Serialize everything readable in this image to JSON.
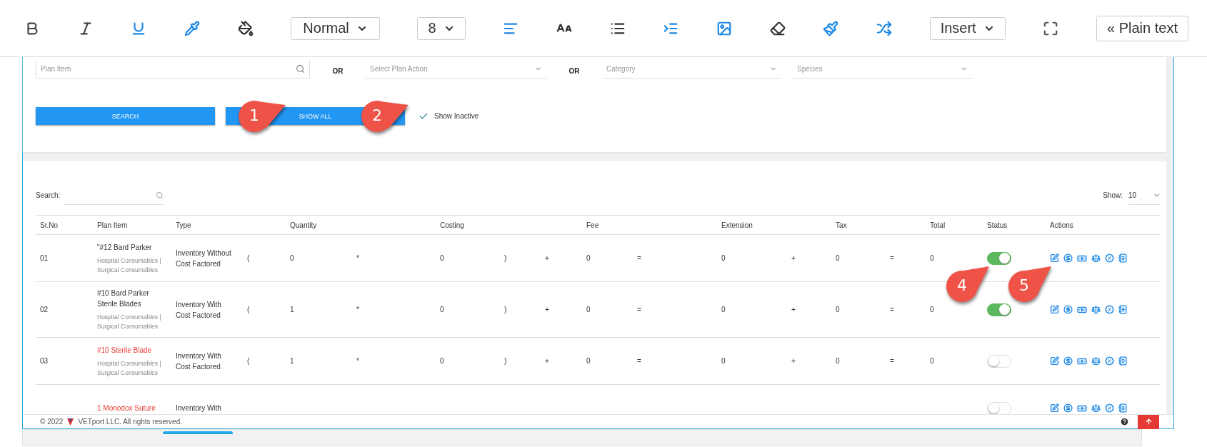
{
  "toolbar": {
    "format_dropdown": {
      "value": "Normal"
    },
    "size_dropdown": {
      "value": "8"
    },
    "insert_dropdown": {
      "label": "Insert"
    },
    "plain_text_button": {
      "label": "« Plain text"
    }
  },
  "filters": {
    "plan_item": {
      "placeholder": "Plan Item"
    },
    "or_labels": [
      "OR",
      "OR"
    ],
    "plan_action": {
      "placeholder": "Select Plan Action"
    },
    "category": {
      "placeholder": "Category"
    },
    "species": {
      "placeholder": "Species"
    },
    "buttons": [
      "SEARCH",
      "SHOW ALL"
    ],
    "show_inactive": {
      "label": "Show Inactive",
      "checked": true
    }
  },
  "table": {
    "search_label": "Search:",
    "show_label": "Show:",
    "page_size": "10",
    "columns": [
      "Sr.No",
      "Plan Item",
      "Type",
      "Quantity",
      "Costing",
      "Fee",
      "Extension",
      "Tax",
      "Total",
      "Status",
      "Actions"
    ],
    "rows": [
      {
        "sr": "01",
        "name": "\"#12 Bard Parker",
        "active": true,
        "category": "Hospital Consumables | Surgical Consumables",
        "type": "Inventory Without Cost Factored",
        "formula": [
          "(",
          "0",
          "*",
          "0",
          ")",
          "+",
          "0",
          "=",
          "0",
          "+",
          "0",
          "=",
          "0"
        ]
      },
      {
        "sr": "02",
        "name": "#10 Bard Parker Sterile Blades",
        "active": true,
        "category": "Hospital Consumables | Surgical Consumables",
        "type": "Inventory With Cost Factored",
        "formula": [
          "(",
          "1",
          "*",
          "0",
          ")",
          "+",
          "0",
          "=",
          "0",
          "+",
          "0",
          "=",
          "0"
        ]
      },
      {
        "sr": "03",
        "name": "#10 Sterile Blade",
        "active": false,
        "category": "Hospital Consumables | Surgical Consumables",
        "type": "Inventory With Cost Factored",
        "formula": [
          "(",
          "1",
          "*",
          "0",
          ")",
          "+",
          "0",
          "=",
          "0",
          "+",
          "0",
          "=",
          "0"
        ]
      },
      {
        "name": "1 Monodox Suture",
        "active": false,
        "type": "Inventory With"
      }
    ]
  },
  "footer": {
    "copyright": "© 2022",
    "company": "VETport LLC. All rights reserved."
  },
  "callouts": [
    {
      "label": "1"
    },
    {
      "label": "2"
    },
    {
      "label": "4"
    },
    {
      "label": "5"
    }
  ]
}
